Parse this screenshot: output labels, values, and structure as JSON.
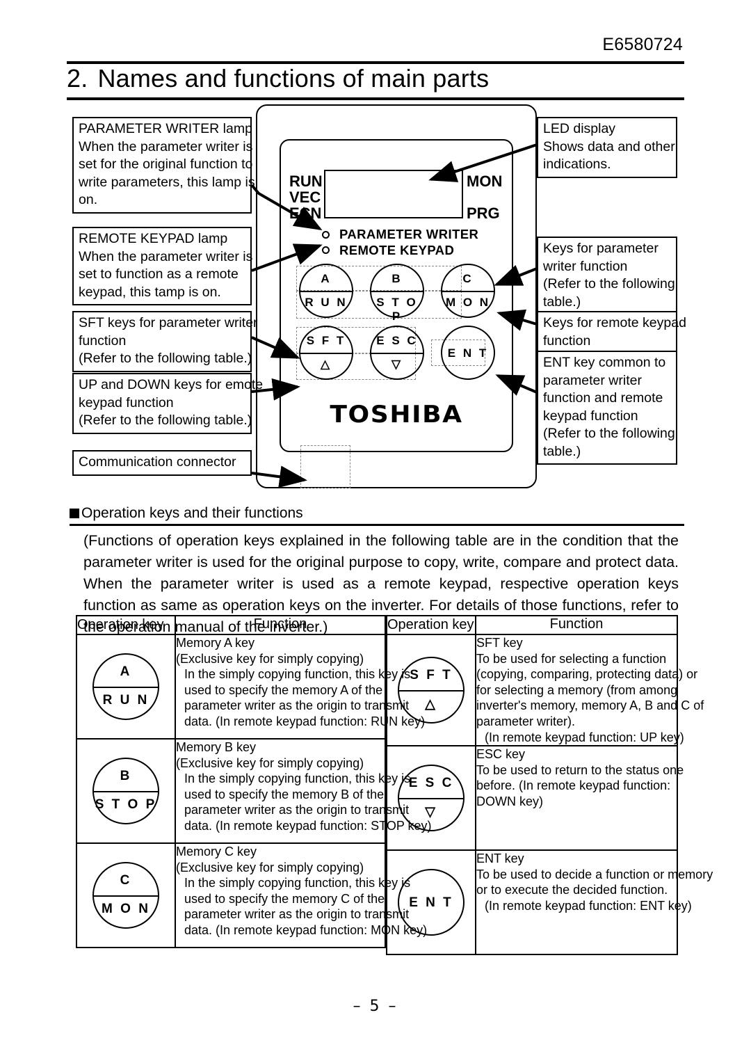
{
  "header": {
    "doc_code": "E6580724",
    "chapter_number": "2.",
    "chapter_title": "Names and functions of main parts"
  },
  "diagram": {
    "callouts": {
      "parameter_writer_lamp": [
        "PARAMETER WRITER lamp",
        "When the parameter writer is",
        "set for the original function to",
        "write parameters, this lamp is",
        "on."
      ],
      "remote_keypad_lamp": [
        "REMOTE KEYPAD lamp",
        "When the parameter writer is",
        "set to function as a remote",
        "keypad, this tamp is on."
      ],
      "sft_keys": [
        "SFT keys for parameter writer",
        "function",
        "(Refer to the following table.)"
      ],
      "up_down_keys": [
        "UP and DOWN keys for emote",
        "keypad function",
        "(Refer to the following table.)"
      ],
      "communication_connector": [
        "Communication connector"
      ],
      "led_display": [
        "LED display",
        "Shows data and other",
        "indications."
      ],
      "keys_parameter_writer": [
        "Keys for parameter",
        "writer function",
        "(Refer to the following",
        "table.)"
      ],
      "keys_remote_keypad": [
        "Keys for remote keypad",
        "function"
      ],
      "ent_key": [
        "ENT key common to",
        "parameter writer",
        "function and remote",
        "keypad function",
        "(Refer to the following",
        "table.)"
      ]
    },
    "device": {
      "status_left": [
        "RUN",
        "VEC",
        "ECN"
      ],
      "status_mon": "MON",
      "status_prg": "PRG",
      "lamp_label_parameter_writer": "PARAMETER WRITER",
      "lamp_label_remote_keypad": "REMOTE KEYPAD",
      "brand": "TOSHIBA",
      "keys": [
        {
          "top": "A",
          "bottom": "R U N"
        },
        {
          "top": "B",
          "bottom": "S T O P"
        },
        {
          "top": "C",
          "bottom": "M O N"
        },
        {
          "top": "S F T",
          "bottom": "△"
        },
        {
          "top": "E S C",
          "bottom": "▽"
        },
        {
          "single": "E N T"
        }
      ]
    }
  },
  "section": {
    "heading": "Operation keys and their functions",
    "intro": "(Functions of operation keys explained in the following table are in the condition that the parameter writer is used for the original purpose to copy, write, compare and protect data. When the parameter writer is used as a remote keypad, respective operation keys function as same as operation keys on the inverter. For details of those functions, refer to the operation manual of the inverter.)"
  },
  "table": {
    "headers": {
      "operation_key": "Operation key",
      "function": "Function"
    },
    "left_rows": [
      {
        "key": {
          "top": "A",
          "bottom": "R U N"
        },
        "lines": [
          {
            "text": "Memory A key",
            "indent": false
          },
          {
            "text": "(Exclusive key for simply copying)",
            "indent": false
          },
          {
            "text": "In the simply copying function, this key is",
            "indent": true
          },
          {
            "text": "used to specify the memory A of the",
            "indent": true
          },
          {
            "text": "parameter writer as the origin to transmit",
            "indent": true
          },
          {
            "text": "data. (In remote keypad function: RUN key)",
            "indent": true
          }
        ]
      },
      {
        "key": {
          "top": "B",
          "bottom": "S T O P"
        },
        "lines": [
          {
            "text": "Memory B key",
            "indent": false
          },
          {
            "text": "(Exclusive key for simply copying)",
            "indent": false
          },
          {
            "text": "In the simply copying function, this key is",
            "indent": true
          },
          {
            "text": "used to specify the memory B of the",
            "indent": true
          },
          {
            "text": "parameter writer as the origin to transmit",
            "indent": true
          },
          {
            "text": "data. (In remote keypad function: STOP key)",
            "indent": true
          }
        ]
      },
      {
        "key": {
          "top": "C",
          "bottom": "M O N"
        },
        "lines": [
          {
            "text": "Memory C key",
            "indent": false
          },
          {
            "text": "(Exclusive key for simply copying)",
            "indent": false
          },
          {
            "text": "In the simply copying function, this key is",
            "indent": true
          },
          {
            "text": "used to specify the memory C of the",
            "indent": true
          },
          {
            "text": "parameter writer as the origin to transmit",
            "indent": true
          },
          {
            "text": "data. (In remote keypad function: MON key)",
            "indent": true
          }
        ]
      }
    ],
    "right_rows": [
      {
        "key": {
          "top": "S F T",
          "bottom": "△"
        },
        "lines": [
          {
            "text": "SFT key",
            "indent": false
          },
          {
            "text": "To be used for selecting a function",
            "indent": false
          },
          {
            "text": "(copying, comparing, protecting data) or",
            "indent": false
          },
          {
            "text": "for selecting a memory (from among",
            "indent": false
          },
          {
            "text": "inverter's memory, memory A, B and C of",
            "indent": false
          },
          {
            "text": "parameter writer).",
            "indent": false
          },
          {
            "text": "(In remote keypad function: UP key)",
            "indent": true
          }
        ]
      },
      {
        "key": {
          "top": "E S C",
          "bottom": "▽"
        },
        "lines": [
          {
            "text": "ESC key",
            "indent": false
          },
          {
            "text": "To be used to return to the status one",
            "indent": false
          },
          {
            "text": "before. (In remote keypad function:",
            "indent": false
          },
          {
            "text": "DOWN key)",
            "indent": false
          }
        ]
      },
      {
        "key": {
          "single": "E N T"
        },
        "lines": [
          {
            "text": "ENT key",
            "indent": false
          },
          {
            "text": "To be used to decide a function or memory",
            "indent": false
          },
          {
            "text": "or to execute the decided function.",
            "indent": false
          },
          {
            "text": "(In remote keypad function: ENT key)",
            "indent": true
          }
        ]
      }
    ]
  },
  "footer": {
    "page_number": "–  5  –"
  }
}
